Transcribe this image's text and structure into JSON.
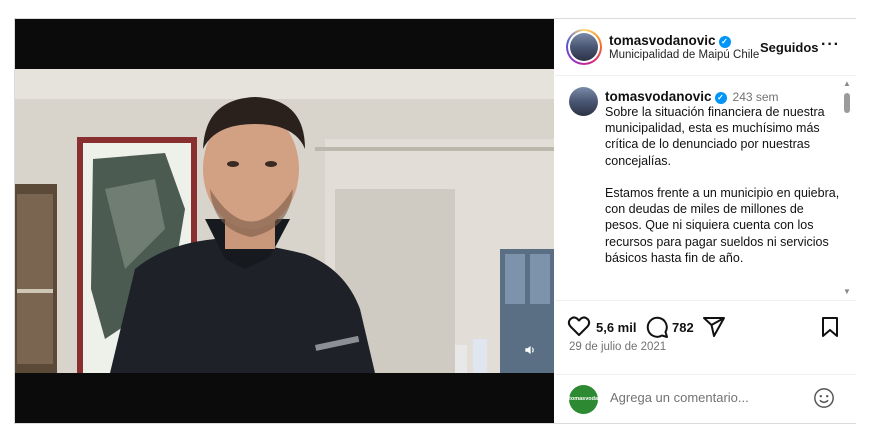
{
  "post": {
    "username": "tomasvodanovic",
    "location": "Municipalidad de Maipú Chile",
    "follow_label": "Seguidos",
    "more_label": "···",
    "caption_time": "243 sem",
    "caption": "Sobre la situación financiera de nuestra municipalidad, esta es muchísimo más crítica de lo denunciado por nuestras concejalías.\n\nEstamos frente a un municipio en quiebra, con deudas de miles de millones de pesos. Que ni siquiera cuenta con los recursos para pagar sueldos ni servicios básicos hasta fin de año.",
    "likes": "5,6 mil",
    "comments": "782",
    "date": "29 de julio de 2021"
  },
  "comment_box": {
    "placeholder": "Agrega un comentario...",
    "avatar_text": "tomasvodanovic.cl"
  },
  "icons": {
    "verified": "verified-badge-icon",
    "heart": "heart-icon",
    "comment": "comment-icon",
    "share": "share-icon",
    "save": "bookmark-icon",
    "emoji": "emoji-icon",
    "mute": "speaker-icon"
  },
  "colors": {
    "verified_blue": "#0095f6",
    "muted_text": "#737373",
    "comment_avatar_green": "#2d8a33"
  }
}
